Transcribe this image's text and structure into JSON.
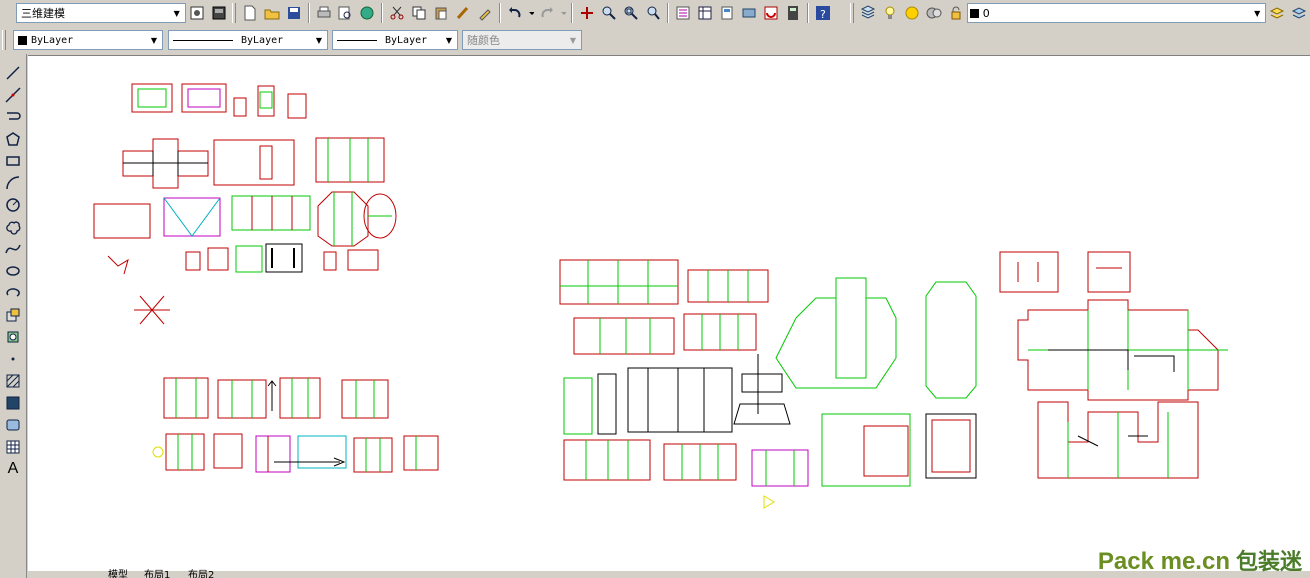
{
  "toolbar1": {
    "workspace_value": "三维建模",
    "layer_value": "0"
  },
  "toolbar2": {
    "color_value": "ByLayer",
    "linetype_value": "ByLayer",
    "lineweight_value": "ByLayer",
    "plotstyle_value": "随颜色"
  },
  "layout_tabs": {
    "model_label": "模型",
    "layout1_label": "布局1",
    "layout2_label": "布局2"
  },
  "watermark": {
    "text_main": "Pack me.cn",
    "text_brand": "包装迷"
  },
  "colors": {
    "die_red": "#c00000",
    "die_green": "#00c800",
    "die_magenta": "#c000c0",
    "die_cyan": "#00b0c0",
    "die_black": "#000000",
    "canvas_bg": "#ffffff"
  },
  "icons": {
    "top_row": [
      "workspace-settings-icon",
      "workspace-icon",
      "new-icon",
      "open-icon",
      "save-icon",
      "print-icon",
      "print-preview-icon",
      "publish-icon",
      "cut-icon",
      "copy-icon",
      "paste-icon",
      "match-properties-icon",
      "block-editor-icon",
      "undo-icon",
      "redo-icon",
      "pan-icon",
      "zoom-realtime-icon",
      "zoom-window-icon",
      "zoom-previous-icon",
      "properties-icon",
      "design-center-icon",
      "tool-palettes-icon",
      "sheet-set-icon",
      "markup-icon",
      "quickcalc-icon",
      "help-icon",
      "layer-properties-icon",
      "layer-state-icons",
      "make-current-icon",
      "layer-previous-icon"
    ],
    "left_tools": [
      "line-icon",
      "construction-line-icon",
      "polyline-icon",
      "polygon-icon",
      "rectangle-icon",
      "arc-icon",
      "circle-icon",
      "revision-cloud-icon",
      "spline-icon",
      "ellipse-icon",
      "ellipse-arc-icon",
      "insert-block-icon",
      "make-block-icon",
      "point-icon",
      "hatch-icon",
      "gradient-icon",
      "region-icon",
      "table-icon",
      "multiline-text-icon"
    ]
  }
}
